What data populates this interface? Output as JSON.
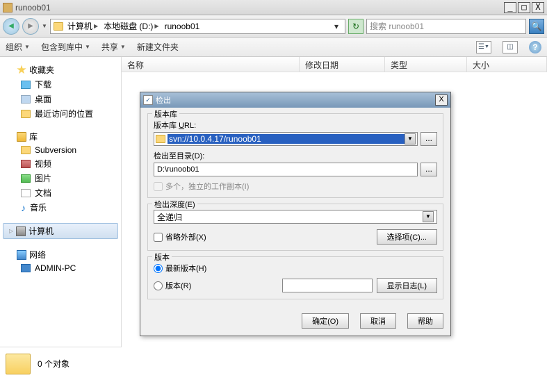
{
  "titlebar": {
    "title": "runoob01"
  },
  "breadcrumb": {
    "root": "计算机",
    "drive": "本地磁盘 (D:)",
    "folder": "runoob01"
  },
  "search": {
    "placeholder": "搜索 runoob01"
  },
  "toolbar": {
    "organize": "组织",
    "include": "包含到库中",
    "share": "共享",
    "newfolder": "新建文件夹"
  },
  "columns": {
    "name": "名称",
    "date": "修改日期",
    "type": "类型",
    "size": "大小"
  },
  "sidebar": {
    "favorites": {
      "label": "收藏夹",
      "downloads": "下载",
      "desktop": "桌面",
      "recent": "最近访问的位置"
    },
    "libraries": {
      "label": "库",
      "subversion": "Subversion",
      "video": "视频",
      "pictures": "图片",
      "documents": "文档",
      "music": "音乐"
    },
    "computer": "计算机",
    "network": {
      "label": "网络",
      "pc": "ADMIN-PC"
    }
  },
  "status": {
    "count": "0 个对象"
  },
  "dialog": {
    "title": "检出",
    "repo": {
      "legend": "版本库",
      "url_label": "版本库 URL:",
      "url_value": "svn://10.0.4.17/runoob01",
      "dir_label": "检出至目录(D):",
      "dir_value": "D:\\runoob01",
      "multi_label": "多个，独立的工作副本(I)"
    },
    "depth": {
      "legend": "检出深度(E)",
      "value": "全递归",
      "omit_label": "省略外部(X)",
      "choose_btn": "选择项(C)..."
    },
    "version": {
      "legend": "版本",
      "head": "最新版本(H)",
      "rev": "版本(R)",
      "showlog": "显示日志(L)"
    },
    "buttons": {
      "ok": "确定(O)",
      "cancel": "取消",
      "help": "帮助"
    }
  }
}
